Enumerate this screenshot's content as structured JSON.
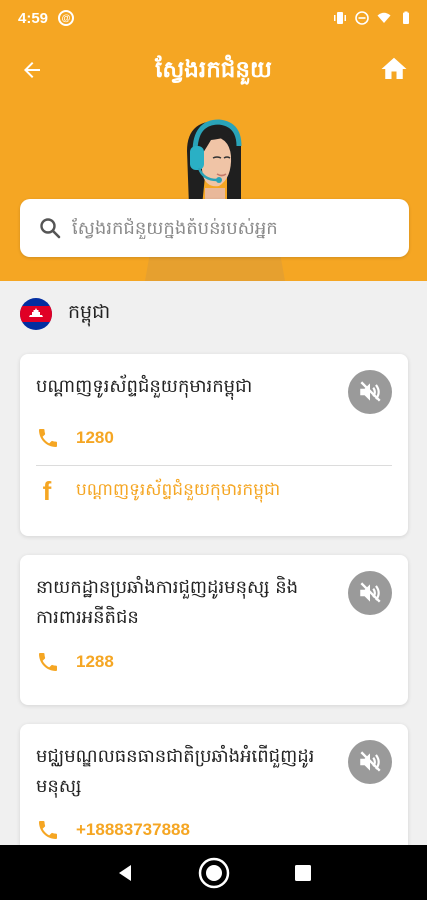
{
  "status_bar": {
    "time": "4:59",
    "icons": [
      "notification-icon",
      "vibrate-icon",
      "do-not-disturb-icon",
      "wifi-icon",
      "battery-icon"
    ]
  },
  "header": {
    "title": "ស្វែងរកជំនួយ",
    "back_icon": "arrow-left-icon",
    "home_icon": "home-icon",
    "illustration": "support-agent-headset"
  },
  "search": {
    "placeholder": "ស្វែងរកជំនួយក្នុងតំបន់របស់អ្នក",
    "value": ""
  },
  "country": {
    "name": "កម្ពុជា",
    "flag_icon": "cambodia-flag-icon"
  },
  "cards": [
    {
      "title": "បណ្ដាញទូរស័ព្ទជំនួយកុមារកម្ពុជា",
      "phone": "1280",
      "facebook": "បណ្ដាញទូរស័ព្ទជំនួយកុមារកម្ពុជា"
    },
    {
      "title": "នាយកដ្ឋានប្រឆាំងការជួញដូរមនុស្ស និងការពារអនីតិជន",
      "phone": "1288"
    },
    {
      "title": "មជ្ឈមណ្ឌលធនធានជាតិប្រឆាំងអំពើជួញដូរមនុស្ស",
      "phone": "+18883737888"
    }
  ],
  "colors": {
    "accent": "#f5a623",
    "speaker_bg": "#9a9a9a",
    "background": "#f0f0f0"
  },
  "nav": {
    "icons": [
      "back-triangle-icon",
      "home-circle-icon",
      "recents-square-icon"
    ]
  }
}
